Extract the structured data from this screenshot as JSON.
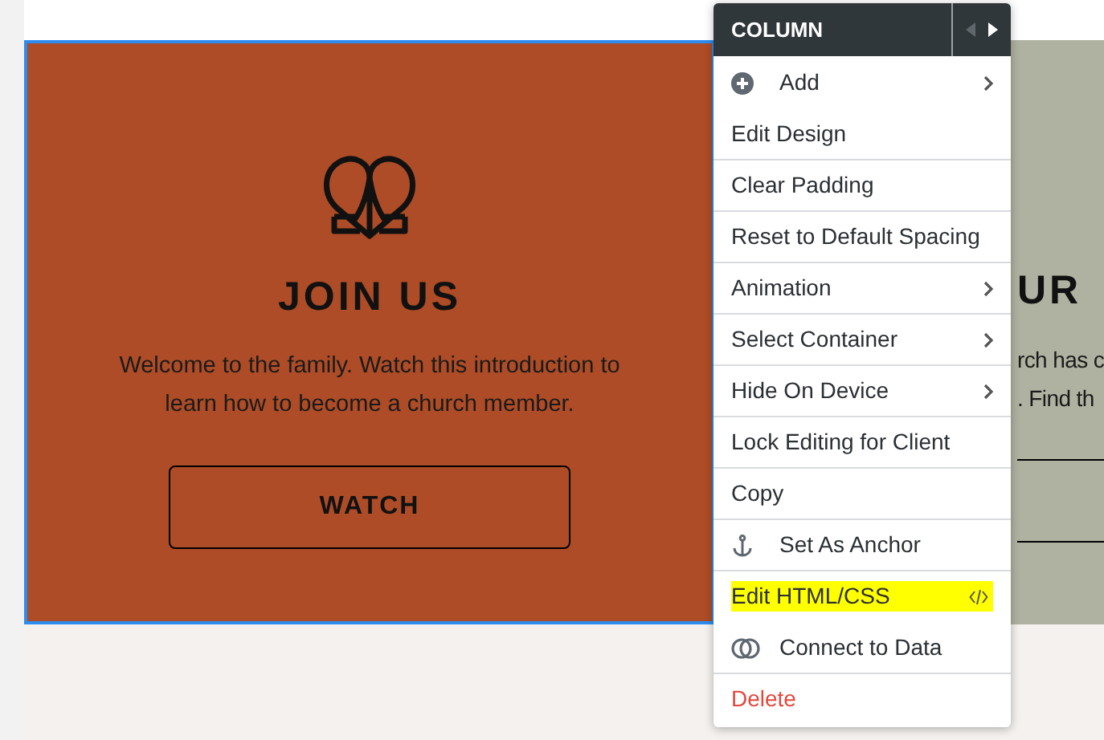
{
  "left_column": {
    "heading": "JOIN US",
    "text": "Welcome to the family. Watch this introduction to learn how to become a church member.",
    "button": "WATCH",
    "selected": true
  },
  "right_column": {
    "heading": "UR",
    "lines": [
      "rch has c",
      ". Find th"
    ]
  },
  "context_menu": {
    "title": "COLUMN",
    "items": [
      {
        "label": "Add",
        "kind": "add",
        "submenu": true,
        "divider": false,
        "highlighted": false
      },
      {
        "label": "Edit Design",
        "kind": "plain",
        "submenu": false,
        "divider": false,
        "highlighted": false
      },
      {
        "label": "Clear Padding",
        "kind": "plain",
        "submenu": false,
        "divider": true,
        "highlighted": false
      },
      {
        "label": "Reset to Default Spacing",
        "kind": "plain",
        "submenu": false,
        "divider": true,
        "highlighted": false
      },
      {
        "label": "Animation",
        "kind": "plain",
        "submenu": true,
        "divider": true,
        "highlighted": false
      },
      {
        "label": "Select Container",
        "kind": "plain",
        "submenu": true,
        "divider": true,
        "highlighted": false
      },
      {
        "label": "Hide On Device",
        "kind": "plain",
        "submenu": true,
        "divider": true,
        "highlighted": false
      },
      {
        "label": "Lock Editing for Client",
        "kind": "plain",
        "submenu": false,
        "divider": true,
        "highlighted": false
      },
      {
        "label": "Copy",
        "kind": "plain",
        "submenu": false,
        "divider": true,
        "highlighted": false
      },
      {
        "label": "Set As Anchor",
        "kind": "anchor",
        "submenu": false,
        "divider": true,
        "highlighted": false
      },
      {
        "label": "Edit HTML/CSS",
        "kind": "code",
        "submenu": false,
        "divider": true,
        "highlighted": true
      },
      {
        "label": "Connect to Data",
        "kind": "data",
        "submenu": false,
        "divider": false,
        "highlighted": false
      },
      {
        "label": "Delete",
        "kind": "danger",
        "submenu": false,
        "divider": true,
        "highlighted": false
      }
    ]
  }
}
